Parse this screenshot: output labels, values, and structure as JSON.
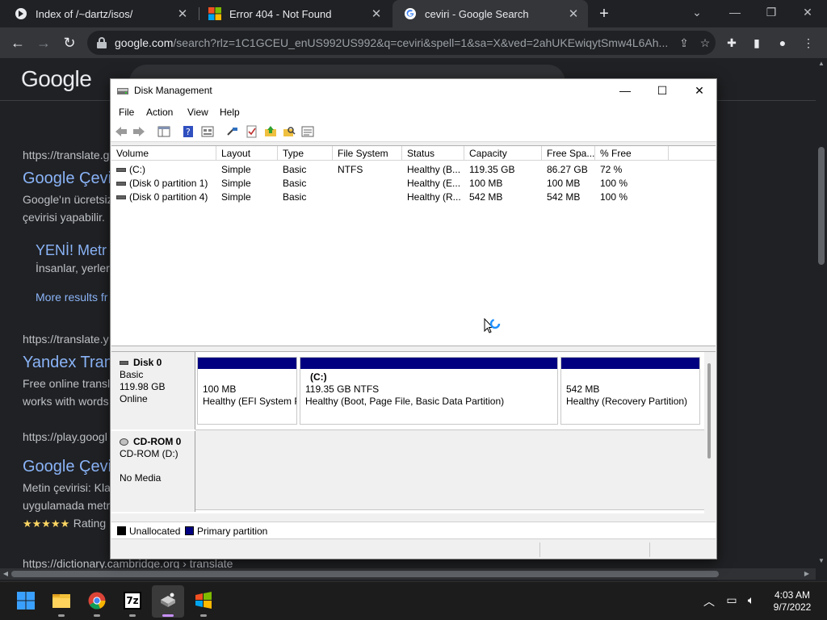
{
  "browser": {
    "tabs": [
      {
        "title": "Index of /~dartz/isos/",
        "favicon": "file-server-icon"
      },
      {
        "title": "Error 404 - Not Found",
        "favicon": "microsoft-icon"
      },
      {
        "title": "ceviri - Google Search",
        "favicon": "google-icon",
        "active": true
      }
    ],
    "url_host": "google.com",
    "url_path": "/search?rlz=1C1GCEU_enUS992US992&q=ceviri&spell=1&sa=X&ved=2ahUKEwiqytSmw4L6Ah..."
  },
  "google": {
    "logo": "Google",
    "search_value": "ceviri",
    "results": [
      {
        "cite": "https://translate.g",
        "title": "Google Çevi",
        "snippet1": "Google'ın ücretsiz",
        "snippet2": "çevirisi yapabilir."
      },
      {
        "sub_title": "YENİ! Metr",
        "sub_snippet": "İnsanlar, yerler",
        "more": "More results fr"
      },
      {
        "cite": "https://translate.y",
        "title": "Yandex Tran",
        "snippet1": "Free online transl",
        "snippet2": "works with words"
      },
      {
        "cite": "https://play.googl",
        "title": "Google Çevi",
        "snippet1": "Metin çevirisi: Kla",
        "snippet2": "uygulamada metr",
        "stars": "★★★★★",
        "rating": "Rating"
      },
      {
        "cite": "https://dictionary.cambridge.org › translate"
      }
    ]
  },
  "disk_management": {
    "title": "Disk Management",
    "menu": [
      "File",
      "Action",
      "View",
      "Help"
    ],
    "columns": [
      "Volume",
      "Layout",
      "Type",
      "File System",
      "Status",
      "Capacity",
      "Free Spa...",
      "% Free"
    ],
    "volumes": [
      {
        "volume": "(C:)",
        "layout": "Simple",
        "type": "Basic",
        "fs": "NTFS",
        "status": "Healthy (B...",
        "capacity": "119.35 GB",
        "free": "86.27 GB",
        "pct": "72 %"
      },
      {
        "volume": "(Disk 0 partition 1)",
        "layout": "Simple",
        "type": "Basic",
        "fs": "",
        "status": "Healthy (E...",
        "capacity": "100 MB",
        "free": "100 MB",
        "pct": "100 %"
      },
      {
        "volume": "(Disk 0 partition 4)",
        "layout": "Simple",
        "type": "Basic",
        "fs": "",
        "status": "Healthy (R...",
        "capacity": "542 MB",
        "free": "542 MB",
        "pct": "100 %"
      }
    ],
    "disk0": {
      "name": "Disk 0",
      "type": "Basic",
      "size": "119.98 GB",
      "state": "Online",
      "partitions": [
        {
          "line1": "",
          "line2": "100 MB",
          "line3": "Healthy (EFI System Partition)"
        },
        {
          "line1": "(C:)",
          "line2": "119.35 GB NTFS",
          "line3": "Healthy (Boot, Page File, Basic Data Partition)"
        },
        {
          "line1": "",
          "line2": "542 MB",
          "line3": "Healthy (Recovery Partition)"
        }
      ]
    },
    "cdrom": {
      "name": "CD-ROM 0",
      "drive": "CD-ROM (D:)",
      "media": "No Media"
    },
    "legend": [
      {
        "label": "Unallocated",
        "color": "#000000"
      },
      {
        "label": "Primary partition",
        "color": "#000080"
      }
    ]
  },
  "taskbar": {
    "apps": [
      "start-icon",
      "file-explorer-icon",
      "chrome-icon",
      "7zip-icon",
      "disk-management-icon",
      "windows-media-icon"
    ],
    "label_7z": "7z",
    "time": "4:03 AM",
    "date": "9/7/2022"
  }
}
